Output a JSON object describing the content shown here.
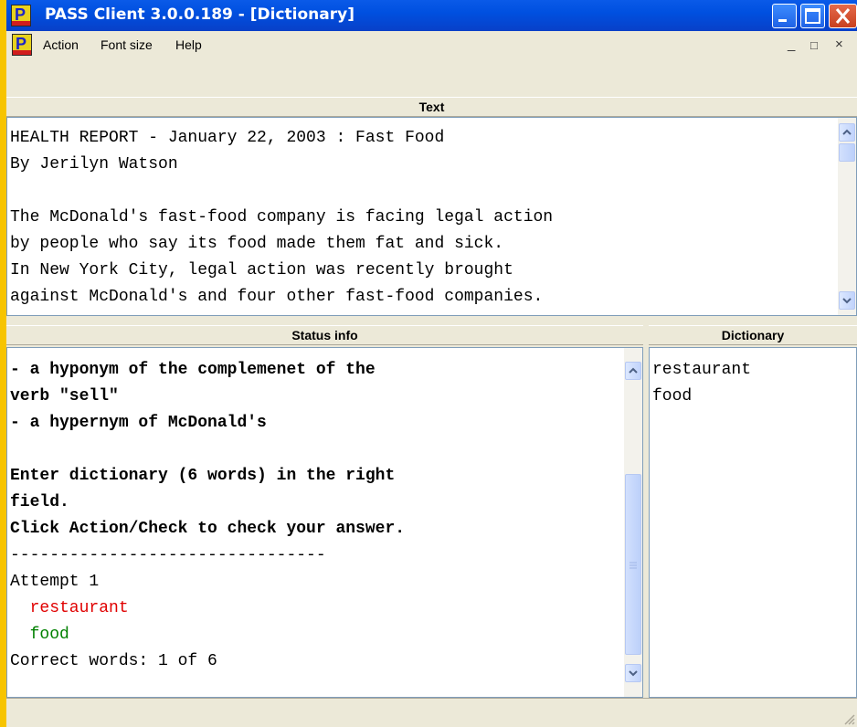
{
  "window": {
    "title": "PASS Client 3.0.0.189 - [Dictionary]",
    "app_icon_letter": "P"
  },
  "menu": {
    "items": [
      "Action",
      "Font size",
      "Help"
    ],
    "mdi_controls": [
      "_",
      "□",
      "×"
    ]
  },
  "text_pane": {
    "header": "Text",
    "lines": [
      "HEALTH REPORT - January 22, 2003 : Fast Food",
      "By Jerilyn Watson",
      "",
      "The McDonald's fast-food company is facing legal action",
      "by people who say its food made them fat and sick.",
      "In New York City, legal action was recently brought",
      "against McDonald's and four other fast-food companies."
    ]
  },
  "status_pane": {
    "header": "Status info",
    "lines": [
      "- a hyponym of the complemenet of the",
      "verb \"sell\"",
      "- a hypernym of McDonald's",
      "",
      "Enter dictionary (6 words) in the right",
      "field.",
      "Click Action/Check to check your answer.",
      "--------------------------------",
      "Attempt 1",
      "  restaurant",
      "  food",
      "Correct words: 1 of 6"
    ],
    "wrong_color": "#e00000",
    "right_color": "#008000"
  },
  "dictionary_pane": {
    "header": "Dictionary",
    "entries": [
      "restaurant",
      "food"
    ]
  },
  "colors": {
    "desktop": "#f7c400",
    "titlebar": "#0050e0"
  }
}
